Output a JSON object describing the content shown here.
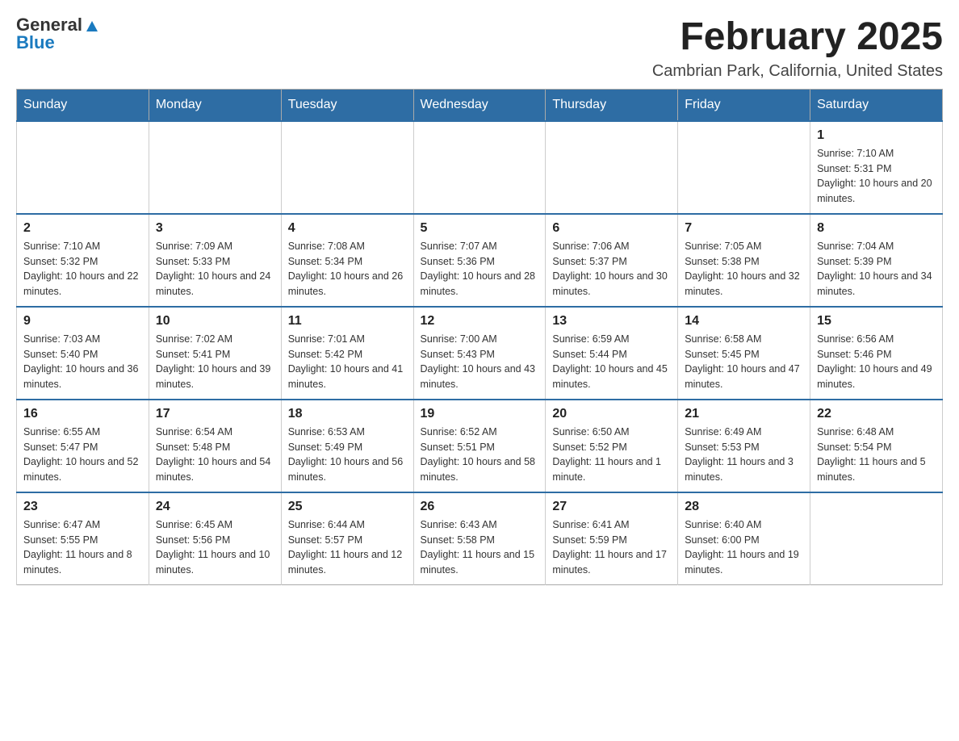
{
  "logo": {
    "general": "General",
    "blue": "Blue"
  },
  "title": "February 2025",
  "subtitle": "Cambrian Park, California, United States",
  "days_header": [
    "Sunday",
    "Monday",
    "Tuesday",
    "Wednesday",
    "Thursday",
    "Friday",
    "Saturday"
  ],
  "weeks": [
    [
      {
        "day": "",
        "sunrise": "",
        "sunset": "",
        "daylight": ""
      },
      {
        "day": "",
        "sunrise": "",
        "sunset": "",
        "daylight": ""
      },
      {
        "day": "",
        "sunrise": "",
        "sunset": "",
        "daylight": ""
      },
      {
        "day": "",
        "sunrise": "",
        "sunset": "",
        "daylight": ""
      },
      {
        "day": "",
        "sunrise": "",
        "sunset": "",
        "daylight": ""
      },
      {
        "day": "",
        "sunrise": "",
        "sunset": "",
        "daylight": ""
      },
      {
        "day": "1",
        "sunrise": "Sunrise: 7:10 AM",
        "sunset": "Sunset: 5:31 PM",
        "daylight": "Daylight: 10 hours and 20 minutes."
      }
    ],
    [
      {
        "day": "2",
        "sunrise": "Sunrise: 7:10 AM",
        "sunset": "Sunset: 5:32 PM",
        "daylight": "Daylight: 10 hours and 22 minutes."
      },
      {
        "day": "3",
        "sunrise": "Sunrise: 7:09 AM",
        "sunset": "Sunset: 5:33 PM",
        "daylight": "Daylight: 10 hours and 24 minutes."
      },
      {
        "day": "4",
        "sunrise": "Sunrise: 7:08 AM",
        "sunset": "Sunset: 5:34 PM",
        "daylight": "Daylight: 10 hours and 26 minutes."
      },
      {
        "day": "5",
        "sunrise": "Sunrise: 7:07 AM",
        "sunset": "Sunset: 5:36 PM",
        "daylight": "Daylight: 10 hours and 28 minutes."
      },
      {
        "day": "6",
        "sunrise": "Sunrise: 7:06 AM",
        "sunset": "Sunset: 5:37 PM",
        "daylight": "Daylight: 10 hours and 30 minutes."
      },
      {
        "day": "7",
        "sunrise": "Sunrise: 7:05 AM",
        "sunset": "Sunset: 5:38 PM",
        "daylight": "Daylight: 10 hours and 32 minutes."
      },
      {
        "day": "8",
        "sunrise": "Sunrise: 7:04 AM",
        "sunset": "Sunset: 5:39 PM",
        "daylight": "Daylight: 10 hours and 34 minutes."
      }
    ],
    [
      {
        "day": "9",
        "sunrise": "Sunrise: 7:03 AM",
        "sunset": "Sunset: 5:40 PM",
        "daylight": "Daylight: 10 hours and 36 minutes."
      },
      {
        "day": "10",
        "sunrise": "Sunrise: 7:02 AM",
        "sunset": "Sunset: 5:41 PM",
        "daylight": "Daylight: 10 hours and 39 minutes."
      },
      {
        "day": "11",
        "sunrise": "Sunrise: 7:01 AM",
        "sunset": "Sunset: 5:42 PM",
        "daylight": "Daylight: 10 hours and 41 minutes."
      },
      {
        "day": "12",
        "sunrise": "Sunrise: 7:00 AM",
        "sunset": "Sunset: 5:43 PM",
        "daylight": "Daylight: 10 hours and 43 minutes."
      },
      {
        "day": "13",
        "sunrise": "Sunrise: 6:59 AM",
        "sunset": "Sunset: 5:44 PM",
        "daylight": "Daylight: 10 hours and 45 minutes."
      },
      {
        "day": "14",
        "sunrise": "Sunrise: 6:58 AM",
        "sunset": "Sunset: 5:45 PM",
        "daylight": "Daylight: 10 hours and 47 minutes."
      },
      {
        "day": "15",
        "sunrise": "Sunrise: 6:56 AM",
        "sunset": "Sunset: 5:46 PM",
        "daylight": "Daylight: 10 hours and 49 minutes."
      }
    ],
    [
      {
        "day": "16",
        "sunrise": "Sunrise: 6:55 AM",
        "sunset": "Sunset: 5:47 PM",
        "daylight": "Daylight: 10 hours and 52 minutes."
      },
      {
        "day": "17",
        "sunrise": "Sunrise: 6:54 AM",
        "sunset": "Sunset: 5:48 PM",
        "daylight": "Daylight: 10 hours and 54 minutes."
      },
      {
        "day": "18",
        "sunrise": "Sunrise: 6:53 AM",
        "sunset": "Sunset: 5:49 PM",
        "daylight": "Daylight: 10 hours and 56 minutes."
      },
      {
        "day": "19",
        "sunrise": "Sunrise: 6:52 AM",
        "sunset": "Sunset: 5:51 PM",
        "daylight": "Daylight: 10 hours and 58 minutes."
      },
      {
        "day": "20",
        "sunrise": "Sunrise: 6:50 AM",
        "sunset": "Sunset: 5:52 PM",
        "daylight": "Daylight: 11 hours and 1 minute."
      },
      {
        "day": "21",
        "sunrise": "Sunrise: 6:49 AM",
        "sunset": "Sunset: 5:53 PM",
        "daylight": "Daylight: 11 hours and 3 minutes."
      },
      {
        "day": "22",
        "sunrise": "Sunrise: 6:48 AM",
        "sunset": "Sunset: 5:54 PM",
        "daylight": "Daylight: 11 hours and 5 minutes."
      }
    ],
    [
      {
        "day": "23",
        "sunrise": "Sunrise: 6:47 AM",
        "sunset": "Sunset: 5:55 PM",
        "daylight": "Daylight: 11 hours and 8 minutes."
      },
      {
        "day": "24",
        "sunrise": "Sunrise: 6:45 AM",
        "sunset": "Sunset: 5:56 PM",
        "daylight": "Daylight: 11 hours and 10 minutes."
      },
      {
        "day": "25",
        "sunrise": "Sunrise: 6:44 AM",
        "sunset": "Sunset: 5:57 PM",
        "daylight": "Daylight: 11 hours and 12 minutes."
      },
      {
        "day": "26",
        "sunrise": "Sunrise: 6:43 AM",
        "sunset": "Sunset: 5:58 PM",
        "daylight": "Daylight: 11 hours and 15 minutes."
      },
      {
        "day": "27",
        "sunrise": "Sunrise: 6:41 AM",
        "sunset": "Sunset: 5:59 PM",
        "daylight": "Daylight: 11 hours and 17 minutes."
      },
      {
        "day": "28",
        "sunrise": "Sunrise: 6:40 AM",
        "sunset": "Sunset: 6:00 PM",
        "daylight": "Daylight: 11 hours and 19 minutes."
      },
      {
        "day": "",
        "sunrise": "",
        "sunset": "",
        "daylight": ""
      }
    ]
  ]
}
